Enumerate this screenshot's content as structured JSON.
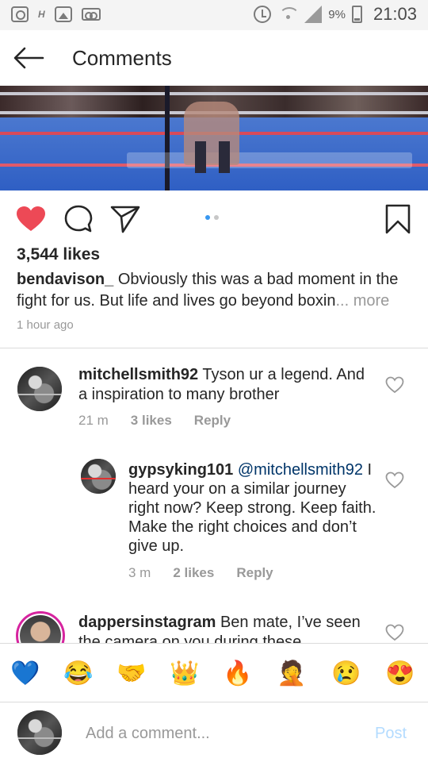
{
  "status_bar": {
    "icons": [
      "instagram-icon",
      "h-indicator-icon",
      "gallery-icon",
      "voicemail-icon",
      "alarm-icon",
      "wifi-icon",
      "signal-icon",
      "battery-icon"
    ],
    "h_indicator": "H",
    "battery_percent": "9%",
    "time": "21:03"
  },
  "header": {
    "back_icon": "arrow-left-icon",
    "title": "Comments"
  },
  "post": {
    "media_icons": [
      "like-heart-icon",
      "comment-icon",
      "share-icon",
      "save-bookmark-icon"
    ],
    "carousel": {
      "count": 2,
      "active": 1
    },
    "likes": "3,544 likes",
    "caption_user": "bendavison_",
    "caption_text": " Obviously this was a bad moment in the fight for us. But life and lives go beyond boxin",
    "caption_more": "... more",
    "time_ago": "1 hour ago",
    "accent": "#ed4956"
  },
  "comments": [
    {
      "user": "mitchellsmith92",
      "text": " Tyson ur a legend. And a inspiration to many brother",
      "time": "21 m",
      "likes": "3 likes",
      "reply": "Reply"
    },
    {
      "user": "gypsyking101",
      "mention": "@mitchellsmith92",
      "text": " I heard your on a similar journey right now? Keep strong. Keep faith. Make the right choices and don’t give up.",
      "time": "3 m",
      "likes": "2 likes",
      "reply": "Reply"
    },
    {
      "user": "dappersinstagram",
      "text": " Ben mate, I’ve seen the camera on you during these"
    }
  ],
  "emoji_bar": [
    {
      "name": "blue-heart-icon",
      "glyph": "💙"
    },
    {
      "name": "tears-of-joy-icon",
      "glyph": "😂"
    },
    {
      "name": "handshake-icon",
      "glyph": "🤝"
    },
    {
      "name": "crown-icon",
      "glyph": "👑"
    },
    {
      "name": "fire-icon",
      "glyph": "🔥"
    },
    {
      "name": "man-facepalm-icon",
      "glyph": "🤦"
    },
    {
      "name": "sad-face-icon",
      "glyph": "😢"
    },
    {
      "name": "heart-eyes-icon",
      "glyph": "😍"
    }
  ],
  "comment_input": {
    "placeholder": "Add a comment...",
    "post_label": "Post",
    "post_color": "#b3dbff"
  },
  "link_color": "#003569",
  "muted_color": "#999999"
}
